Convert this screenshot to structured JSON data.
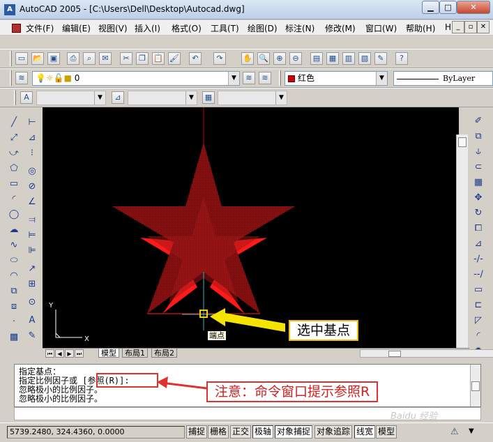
{
  "window": {
    "title": "AutoCAD 2005 - [C:\\Users\\Dell\\Desktop\\Autocad.dwg]",
    "app_icon": "A"
  },
  "menu": [
    "文件(F)",
    "编辑(E)",
    "视图(V)",
    "插入(I)",
    "格式(O)",
    "工具(T)",
    "绘图(D)",
    "标注(N)",
    "修改(M)",
    "窗口(W)",
    "帮助(H)",
    "HDSHM"
  ],
  "layer_combo": {
    "value": "0"
  },
  "color_combo": {
    "value": "红色",
    "swatch": "#d00000"
  },
  "linetype_combo": {
    "value": "ByLayer"
  },
  "tabs": [
    "模型",
    "布局1",
    "布局2"
  ],
  "canvas": {
    "background": "#000000",
    "star_color": "#c00000"
  },
  "tooltip": "端点",
  "command_lines": [
    "指定基点：",
    "指定比例因子或 [参照(R)]:",
    "忽略极小的比例因子。",
    "忽略极小的比例因子。"
  ],
  "coords": "5739.2480, 324.4360, 0.0000",
  "status_buttons": [
    {
      "label": "捕捉",
      "on": false
    },
    {
      "label": "栅格",
      "on": false
    },
    {
      "label": "正交",
      "on": false
    },
    {
      "label": "极轴",
      "on": true
    },
    {
      "label": "对象捕捉",
      "on": true
    },
    {
      "label": "对象追踪",
      "on": false
    },
    {
      "label": "线宽",
      "on": true
    },
    {
      "label": "模型",
      "on": false
    }
  ],
  "callouts": {
    "base_point": "选中基点",
    "note": "注意：命令窗口提示参照R"
  },
  "ucs": {
    "x_label": "X",
    "y_label": "Y"
  },
  "watermark": "Baidu 经验"
}
